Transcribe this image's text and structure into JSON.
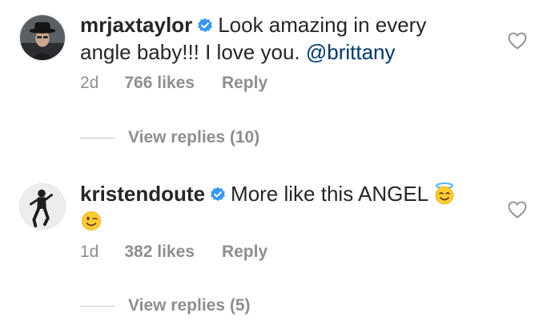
{
  "comments": [
    {
      "username": "mrjaxtaylor",
      "text": "Look amazing in every angle baby!!! I love you.",
      "mention": "@brittany",
      "time": "2d",
      "likes": "766 likes",
      "reply": "Reply",
      "view_replies": "View replies (10)",
      "avatar_icon": "avatar-man-hat",
      "verified_icon": "verified-badge-icon"
    },
    {
      "username": "kristendoute",
      "text": "More like this ANGEL",
      "emojis": [
        "smiling-face-with-halo-emoji",
        "winking-face-emoji"
      ],
      "time": "1d",
      "likes": "382 likes",
      "reply": "Reply",
      "view_replies": "View replies (5)",
      "avatar_icon": "avatar-woman-pose",
      "verified_icon": "verified-badge-icon"
    }
  ],
  "colors": {
    "text": "#262626",
    "muted": "#8e8e8e",
    "mention": "#00376b",
    "verified": "#3897f0"
  }
}
